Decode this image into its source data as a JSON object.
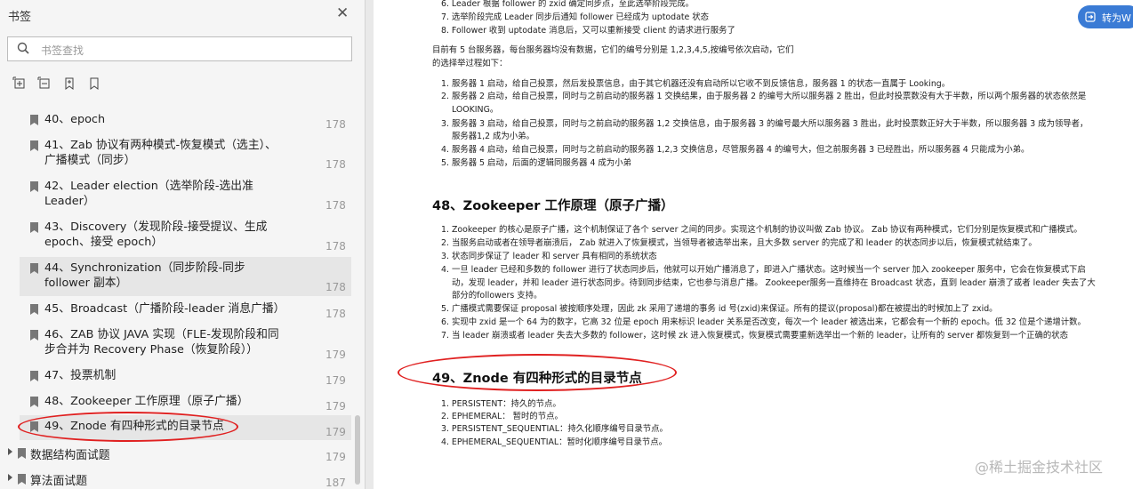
{
  "sidebar": {
    "title": "书签",
    "search_placeholder": "书签查找",
    "items": [
      {
        "text": "40、epoch",
        "page": "178"
      },
      {
        "text": "41、Zab 协议有两种模式-恢复模式（选主）、广播模式（同步）",
        "page": "178"
      },
      {
        "text": "42、Leader election（选举阶段-选出准 Leader）",
        "page": "178"
      },
      {
        "text": "43、Discovery（发现阶段-接受提议、生成 epoch、接受 epoch）",
        "page": "178"
      },
      {
        "text": "44、Synchronization（同步阶段-同步 follower 副本）",
        "page": "178"
      },
      {
        "text": "45、Broadcast（广播阶段-leader 消息广播）",
        "page": "178"
      },
      {
        "text": "46、ZAB 协议 JAVA 实现（FLE-发现阶段和同步合并为 Recovery Phase（恢复阶段））",
        "page": "179"
      },
      {
        "text": "47、投票机制",
        "page": "179"
      },
      {
        "text": "48、Zookeeper 工作原理（原子广播）",
        "page": "179"
      },
      {
        "text": "49、Znode 有四种形式的目录节点",
        "page": "179"
      }
    ],
    "top_items": [
      {
        "text": "数据结构面试题",
        "page": "179"
      },
      {
        "text": "算法面试题",
        "page": "187"
      }
    ]
  },
  "convert_button": "转为W",
  "watermark": "@稀土掘金技术社区",
  "doc": {
    "top_list": [
      "6. Leader 根据 follower 的 zxid 确定同步点，至此选举阶段完成。",
      "7. 选举阶段完成 Leader 同步后通知 follower 已经成为 uptodate 状态",
      "8. Follower 收到 uptodate 消息后，又可以重新接受 client 的请求进行服务了"
    ],
    "intro": [
      "目前有 5 台服务器，每台服务器均没有数据，它们的编号分别是 1,2,3,4,5,按编号依次启动，它们",
      "的选择举过程如下："
    ],
    "vote_list": [
      {
        "n": "1.",
        "t": "服务器 1 启动，给自己投票，然后发投票信息，由于其它机器还没有启动所以它收不到反馈信息，服务器 1 的状态一直属于 Looking。"
      },
      {
        "n": "2.",
        "t": "服务器 2 启动，给自己投票，同时与之前启动的服务器 1 交换结果，由于服务器 2 的编号大所以服务器 2 胜出，但此时投票数没有大于半数，所以两个服务器的状态依然是"
      },
      {
        "n": "",
        "t": "LOOKING。"
      },
      {
        "n": "3.",
        "t": "服务器 3 启动，给自己投票，同时与之前启动的服务器 1,2 交换信息，由于服务器 3 的编号最大所以服务器 3 胜出，此时投票数正好大于半数，所以服务器 3 成为领导者，"
      },
      {
        "n": "",
        "t": "服务器1,2 成为小弟。"
      },
      {
        "n": "4.",
        "t": "服务器 4 启动，给自己投票，同时与之前启动的服务器 1,2,3 交换信息，尽管服务器 4 的编号大，但之前服务器 3 已经胜出，所以服务器 4 只能成为小弟。"
      },
      {
        "n": "5.",
        "t": "服务器 5 启动，后面的逻辑同服务器 4 成为小弟"
      }
    ],
    "h48": "48、Zookeeper 工作原理（原子广播）",
    "list48": [
      {
        "n": "1.",
        "t": "Zookeeper 的核心是原子广播，这个机制保证了各个 server 之间的同步。实现这个机制的协议叫做 Zab 协议。 Zab 协议有两种模式，它们分别是恢复模式和广播模式。"
      },
      {
        "n": "2.",
        "t": "当服务启动或者在领导者崩溃后， Zab 就进入了恢复模式，当领导者被选举出来，且大多数 server 的完成了和 leader 的状态同步以后，恢复模式就结束了。"
      },
      {
        "n": "3.",
        "t": "状态同步保证了 leader 和 server 具有相同的系统状态"
      },
      {
        "n": "4.",
        "t": "一旦 leader 已经和多数的 follower 进行了状态同步后，他就可以开始广播消息了，即进入广播状态。这时候当一个 server 加入 zookeeper 服务中，它会在恢复模式下启"
      },
      {
        "n": "",
        "t": "动，发现 leader，并和 leader 进行状态同步。待到同步结束，它也参与消息广播。 Zookeeper服务一直维持在 Broadcast 状态，直到 leader 崩溃了或者 leader 失去了大"
      },
      {
        "n": "",
        "t": "部分的followers 支持。"
      },
      {
        "n": "5.",
        "t": "广播模式需要保证 proposal 被按顺序处理，因此 zk 采用了递增的事务 id 号(zxid)来保证。所有的提议(proposal)都在被提出的时候加上了 zxid。"
      },
      {
        "n": "6.",
        "t": "实现中 zxid 是一个 64 为的数字，它高 32 位是 epoch 用来标识 leader 关系是否改变，每次一个 leader 被选出来，它都会有一个新的 epoch。低 32 位是个递增计数。"
      },
      {
        "n": "7.",
        "t": "当 leader 崩溃或者 leader 失去大多数的 follower，这时候 zk 进入恢复模式，恢复模式需要重新选举出一个新的 leader，让所有的 server 都恢复到一个正确的状态"
      }
    ],
    "h49": "49、Znode 有四种形式的目录节点",
    "list49": [
      "1. PERSISTENT：持久的节点。",
      "2. EPHEMERAL： 暂时的节点。",
      "3. PERSISTENT_SEQUENTIAL：持久化顺序编号目录节点。",
      "4. EPHEMERAL_SEQUENTIAL：暂时化顺序编号目录节点。"
    ]
  },
  "colors": {
    "annotation": "#e02020",
    "accent": "#3a7bd5"
  }
}
